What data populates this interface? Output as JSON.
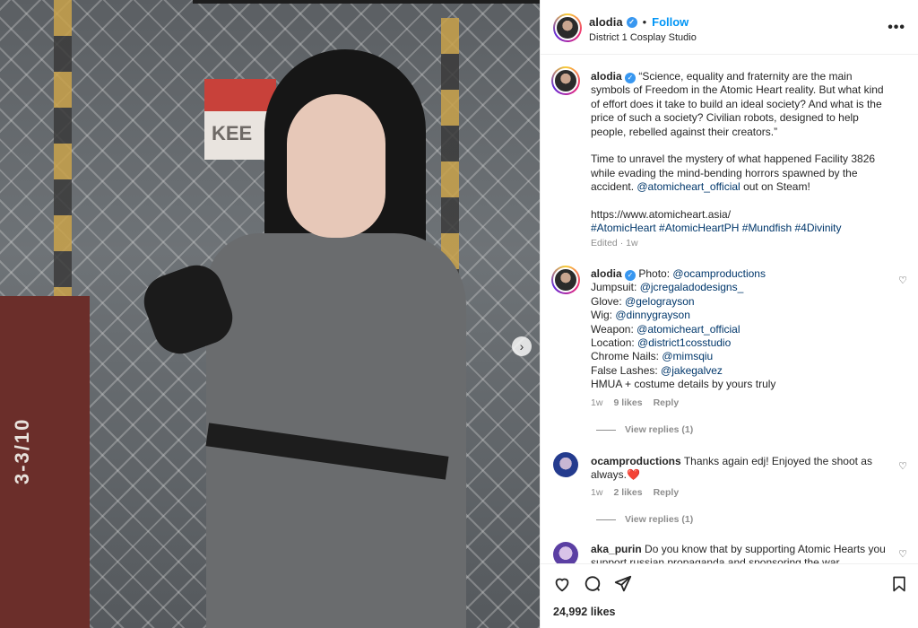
{
  "post": {
    "username": "alodia",
    "follow_label": "Follow",
    "location": "District 1 Cosplay Studio",
    "more_label": "•••",
    "separator": "•"
  },
  "photo": {
    "sign_text": "KEE",
    "box_text": "3-3/10"
  },
  "caption": {
    "username": "alodia",
    "paragraph1": "“Science, equality and fraternity are the main symbols of Freedom in the Atomic Heart reality. But what kind of effort does it take to build an ideal society? And what is the price of such a society? Civilian robots, designed to help people, rebelled against their creators.”",
    "paragraph2_before": "Time to unravel the mystery of what happened Facility 3826 while evading the mind-bending horrors spawned by the accident. ",
    "paragraph2_mention": "@atomicheart_official",
    "paragraph2_after": " out on Steam!",
    "url": "https://www.atomicheart.asia/",
    "hashtags": [
      "#AtomicHeart",
      "#AtomicHeartPH",
      "#Mundfish",
      "#4Divinity"
    ],
    "edited": "Edited · 1w"
  },
  "comments": [
    {
      "username": "alodia",
      "lines": [
        {
          "label": "Photo: ",
          "mention": "@ocamproductions"
        },
        {
          "label": "Jumpsuit: ",
          "mention": "@jcregaladodesigns_"
        },
        {
          "label": "Glove: ",
          "mention": "@gelograyson"
        },
        {
          "label": "Wig: ",
          "mention": "@dinnygrayson"
        },
        {
          "label": "Weapon: ",
          "mention": "@atomicheart_official"
        },
        {
          "label": "Location: ",
          "mention": "@district1cosstudio"
        },
        {
          "label": "Chrome Nails: ",
          "mention": "@mimsqiu"
        },
        {
          "label": "False Lashes: ",
          "mention": "@jakegalvez"
        },
        {
          "label": "HMUA + costume details by yours truly",
          "mention": ""
        }
      ],
      "time": "1w",
      "likes": "9 likes",
      "reply": "Reply",
      "view_replies": "View replies (1)"
    },
    {
      "username": "ocamproductions",
      "text": "Thanks again edj! Enjoyed the shoot as always.",
      "emoji": "❤️",
      "time": "1w",
      "likes": "2 likes",
      "reply": "Reply",
      "view_replies": "View replies (1)"
    },
    {
      "username": "aka_purin",
      "text": "Do you know that by supporting Atomic Hearts you support russian propaganda and sponsoring the war"
    }
  ],
  "footer": {
    "likes": "24,992 likes"
  }
}
